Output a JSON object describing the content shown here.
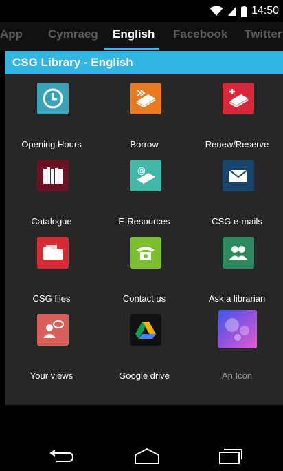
{
  "status": {
    "time": "14:50"
  },
  "tabs": [
    {
      "label": "App"
    },
    {
      "label": "Cymraeg"
    },
    {
      "label": "English"
    },
    {
      "label": "Facebook"
    },
    {
      "label": "Twitter"
    }
  ],
  "header": {
    "title": "CSG Library - English"
  },
  "grid": {
    "items": [
      {
        "label": "Opening Hours",
        "icon": "clock-icon",
        "color": "#3aa3b8"
      },
      {
        "label": "Borrow",
        "icon": "book-borrow-icon",
        "color": "#e87a22"
      },
      {
        "label": "Renew/Reserve",
        "icon": "book-renew-icon",
        "color": "#d8283a"
      },
      {
        "label": "Catalogue",
        "icon": "bookshelf-icon",
        "color": "#6a1224"
      },
      {
        "label": "E-Resources",
        "icon": "ebook-icon",
        "color": "#42b8a8"
      },
      {
        "label": "CSG e-mails",
        "icon": "envelope-icon",
        "color": "#17456e"
      },
      {
        "label": "CSG files",
        "icon": "folder-icon",
        "color": "#d82a35"
      },
      {
        "label": "Contact us",
        "icon": "telephone-icon",
        "color": "#7bbf2e"
      },
      {
        "label": "Ask a librarian",
        "icon": "people-icon",
        "color": "#2e8a5e"
      },
      {
        "label": "Your views",
        "icon": "speech-person-icon",
        "color": "#d9605a"
      },
      {
        "label": "Google drive",
        "icon": "google-drive-icon",
        "color": "#111111"
      },
      {
        "label": "An Icon",
        "icon": "bokeh-image-icon",
        "color": "#7a4fd8"
      }
    ]
  }
}
